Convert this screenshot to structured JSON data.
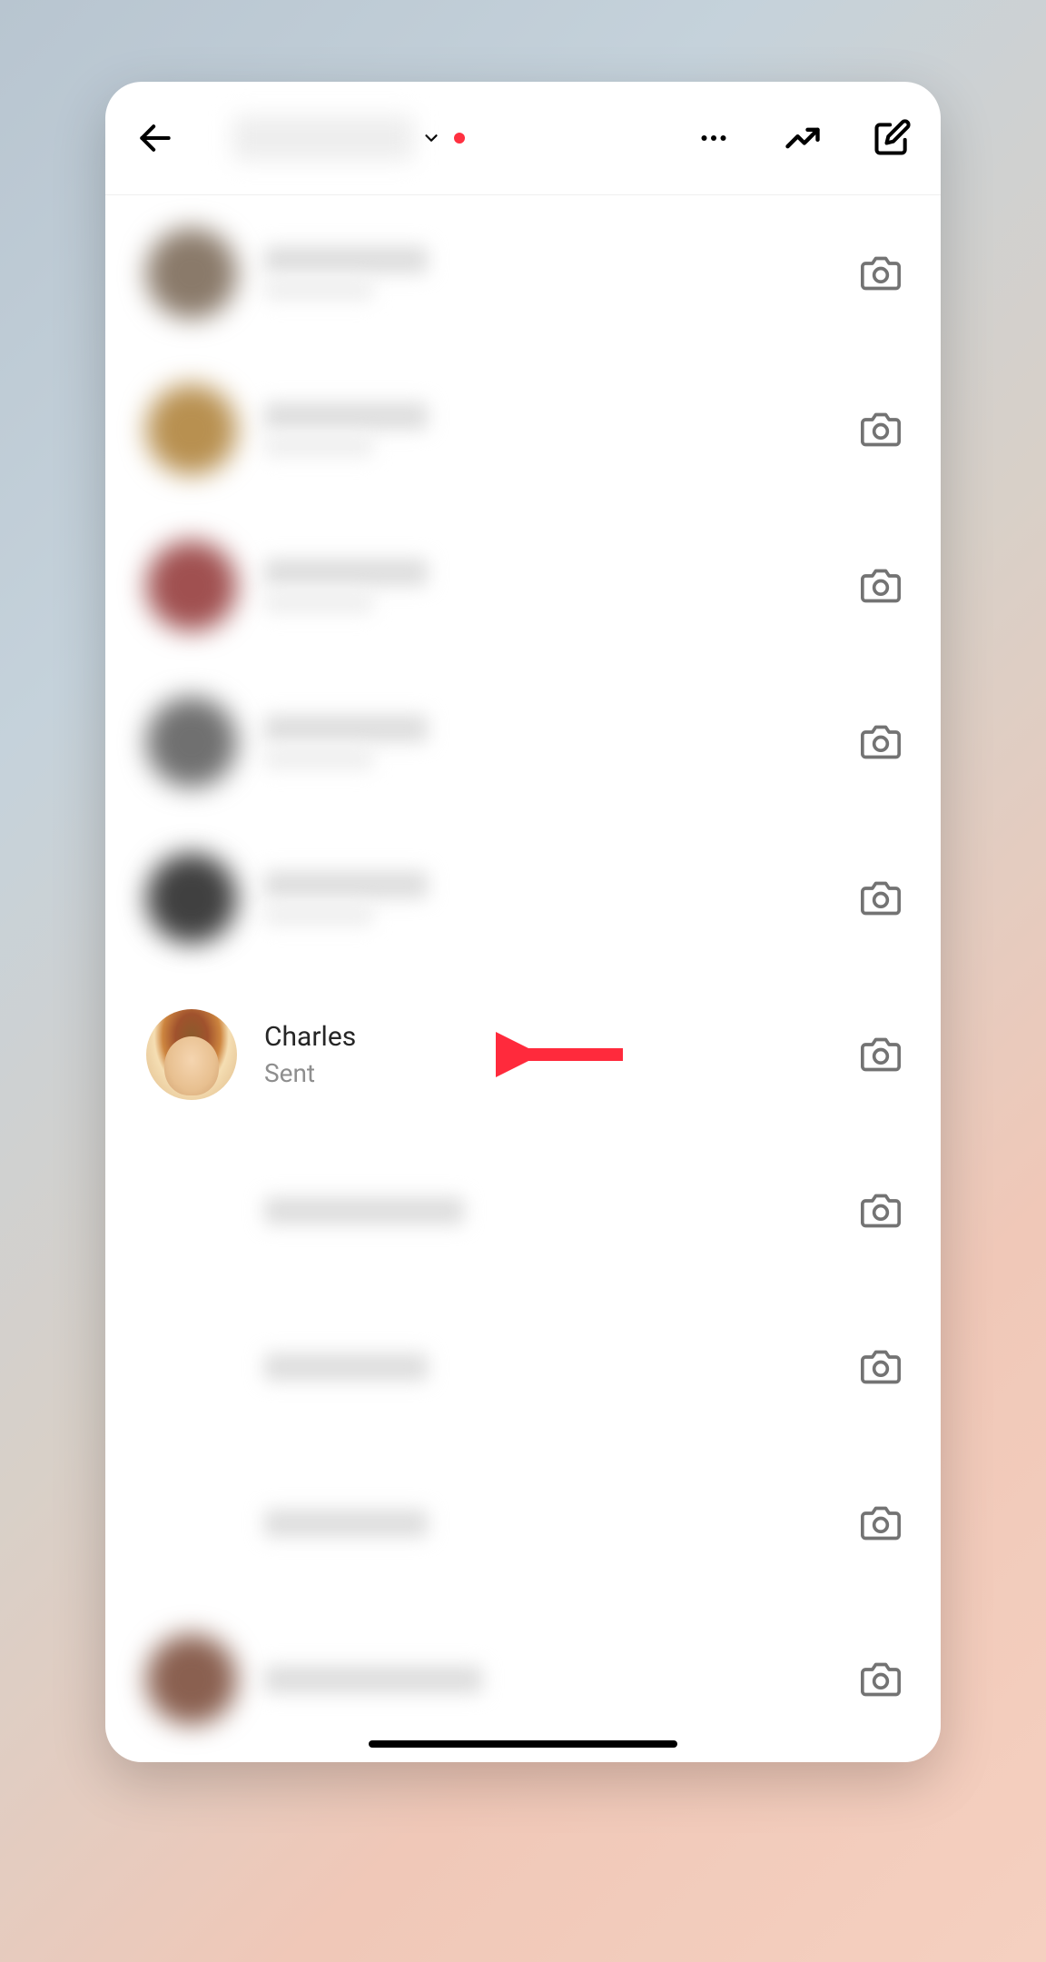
{
  "header": {
    "notification_dot": true
  },
  "conversations": [
    {
      "blurred": true,
      "avatar_tone": "#8a7a6a"
    },
    {
      "blurred": true,
      "avatar_tone": "#b89050"
    },
    {
      "blurred": true,
      "avatar_tone": "#a05050"
    },
    {
      "blurred": true,
      "avatar_tone": "#707070"
    },
    {
      "blurred": true,
      "avatar_tone": "#404040"
    },
    {
      "blurred": false,
      "name": "Charles",
      "status": "Sent",
      "highlighted": true
    },
    {
      "blurred": true,
      "avatar_tone": "#ffffff"
    },
    {
      "blurred": true,
      "avatar_tone": "#ffffff"
    },
    {
      "blurred": true,
      "avatar_tone": "#ffffff"
    },
    {
      "blurred": true,
      "avatar_tone": "#8a6050"
    }
  ]
}
